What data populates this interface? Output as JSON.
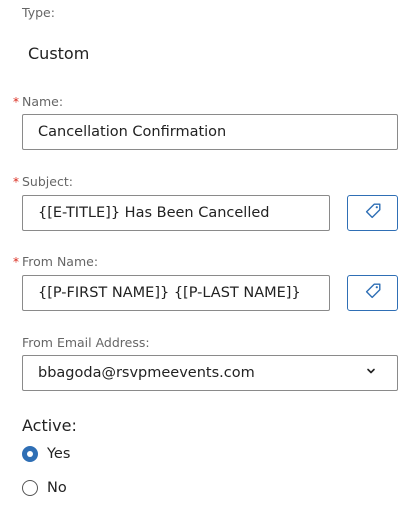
{
  "type_section": {
    "label": "Type:",
    "value": "Custom"
  },
  "name_field": {
    "required_mark": "*",
    "label": "Name:",
    "value": "Cancellation Confirmation"
  },
  "subject_field": {
    "required_mark": "*",
    "label": "Subject:",
    "value": "{[E-TITLE]} Has Been Cancelled",
    "tag_button_icon": "tag-icon"
  },
  "from_name_field": {
    "required_mark": "*",
    "label": "From Name:",
    "value": "{[P-FIRST NAME]} {[P-LAST NAME]}",
    "tag_button_icon": "tag-icon"
  },
  "from_email_field": {
    "label": "From Email Address:",
    "selected_value": "bbagoda@rsvpmeevents.com",
    "dropdown_icon": "chevron-down-icon"
  },
  "active_section": {
    "label": "Active:",
    "options": [
      {
        "label": "Yes",
        "checked": true
      },
      {
        "label": "No",
        "checked": false
      }
    ]
  },
  "colors": {
    "required": "#d9291c",
    "accent": "#2f6fb5",
    "label_text": "#666666",
    "border": "#8a8a8a"
  }
}
